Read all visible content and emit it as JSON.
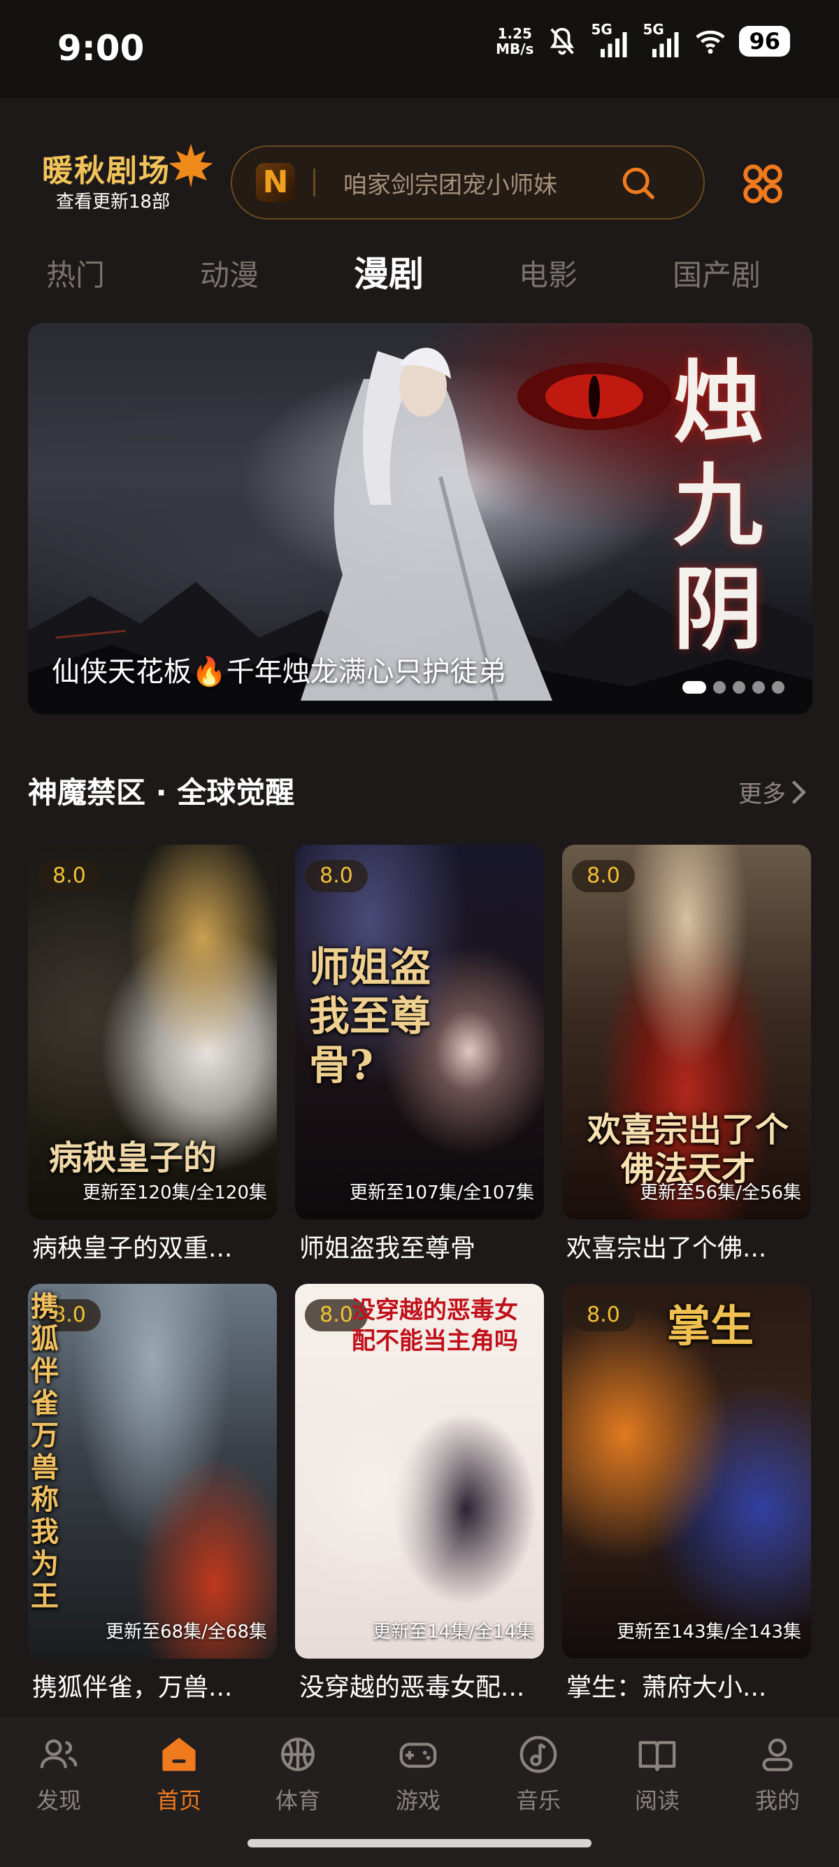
{
  "status_bar": {
    "time": "9:00",
    "net_speed_value": "1.25",
    "net_speed_unit": "MB/s",
    "signal_1": "5G",
    "signal_2": "5G",
    "battery": "96"
  },
  "header": {
    "logo_title": "暖秋剧场",
    "logo_subtitle": "查看更新18部",
    "search_brand": "N",
    "search_placeholder": "咱家剑宗团宠小师妹"
  },
  "tabs": [
    {
      "label": "热门"
    },
    {
      "label": "动漫"
    },
    {
      "label": "漫剧",
      "active": true
    },
    {
      "label": "电影"
    },
    {
      "label": "国产剧"
    }
  ],
  "banner": {
    "poster_title": "烛九阴",
    "caption": "仙侠天花板🔥千年烛龙满心只护徒弟",
    "dots_total": 5,
    "active_dot": 0
  },
  "section": {
    "title": "神魔禁区 · 全球觉醒",
    "more": "更多"
  },
  "cards": [
    {
      "rating": "8.0",
      "episodes": "更新至120集/全120集",
      "title": "病秧皇子的双重...",
      "poster_text": "病秧皇子的"
    },
    {
      "rating": "8.0",
      "episodes": "更新至107集/全107集",
      "title": "师姐盗我至尊骨",
      "poster_text": "师姐盗我至尊骨?"
    },
    {
      "rating": "8.0",
      "episodes": "更新至56集/全56集",
      "title": "欢喜宗出了个佛...",
      "poster_text": "欢喜宗出了个佛法天才"
    },
    {
      "rating": "8.0",
      "episodes": "更新至68集/全68集",
      "title": "携狐伴雀，万兽...",
      "poster_text": "携狐伴雀万兽称我为王"
    },
    {
      "rating": "8.0",
      "episodes": "更新至14集/全14集",
      "title": "没穿越的恶毒女配...",
      "poster_text": "没穿越的恶毒女配不能当主角吗"
    },
    {
      "rating": "8.0",
      "episodes": "更新至143集/全143集",
      "title": "掌生：萧府大小...",
      "poster_text": "掌生"
    }
  ],
  "bottom_nav": [
    {
      "label": "发现",
      "icon": "discover-icon"
    },
    {
      "label": "首页",
      "icon": "home-icon",
      "active": true
    },
    {
      "label": "体育",
      "icon": "basketball-icon"
    },
    {
      "label": "游戏",
      "icon": "gamepad-icon"
    },
    {
      "label": "音乐",
      "icon": "music-icon"
    },
    {
      "label": "阅读",
      "icon": "book-icon"
    },
    {
      "label": "我的",
      "icon": "profile-icon"
    }
  ],
  "colors": {
    "accent": "#f07a1e",
    "rating": "#f2c233",
    "background": "#1d1918"
  }
}
